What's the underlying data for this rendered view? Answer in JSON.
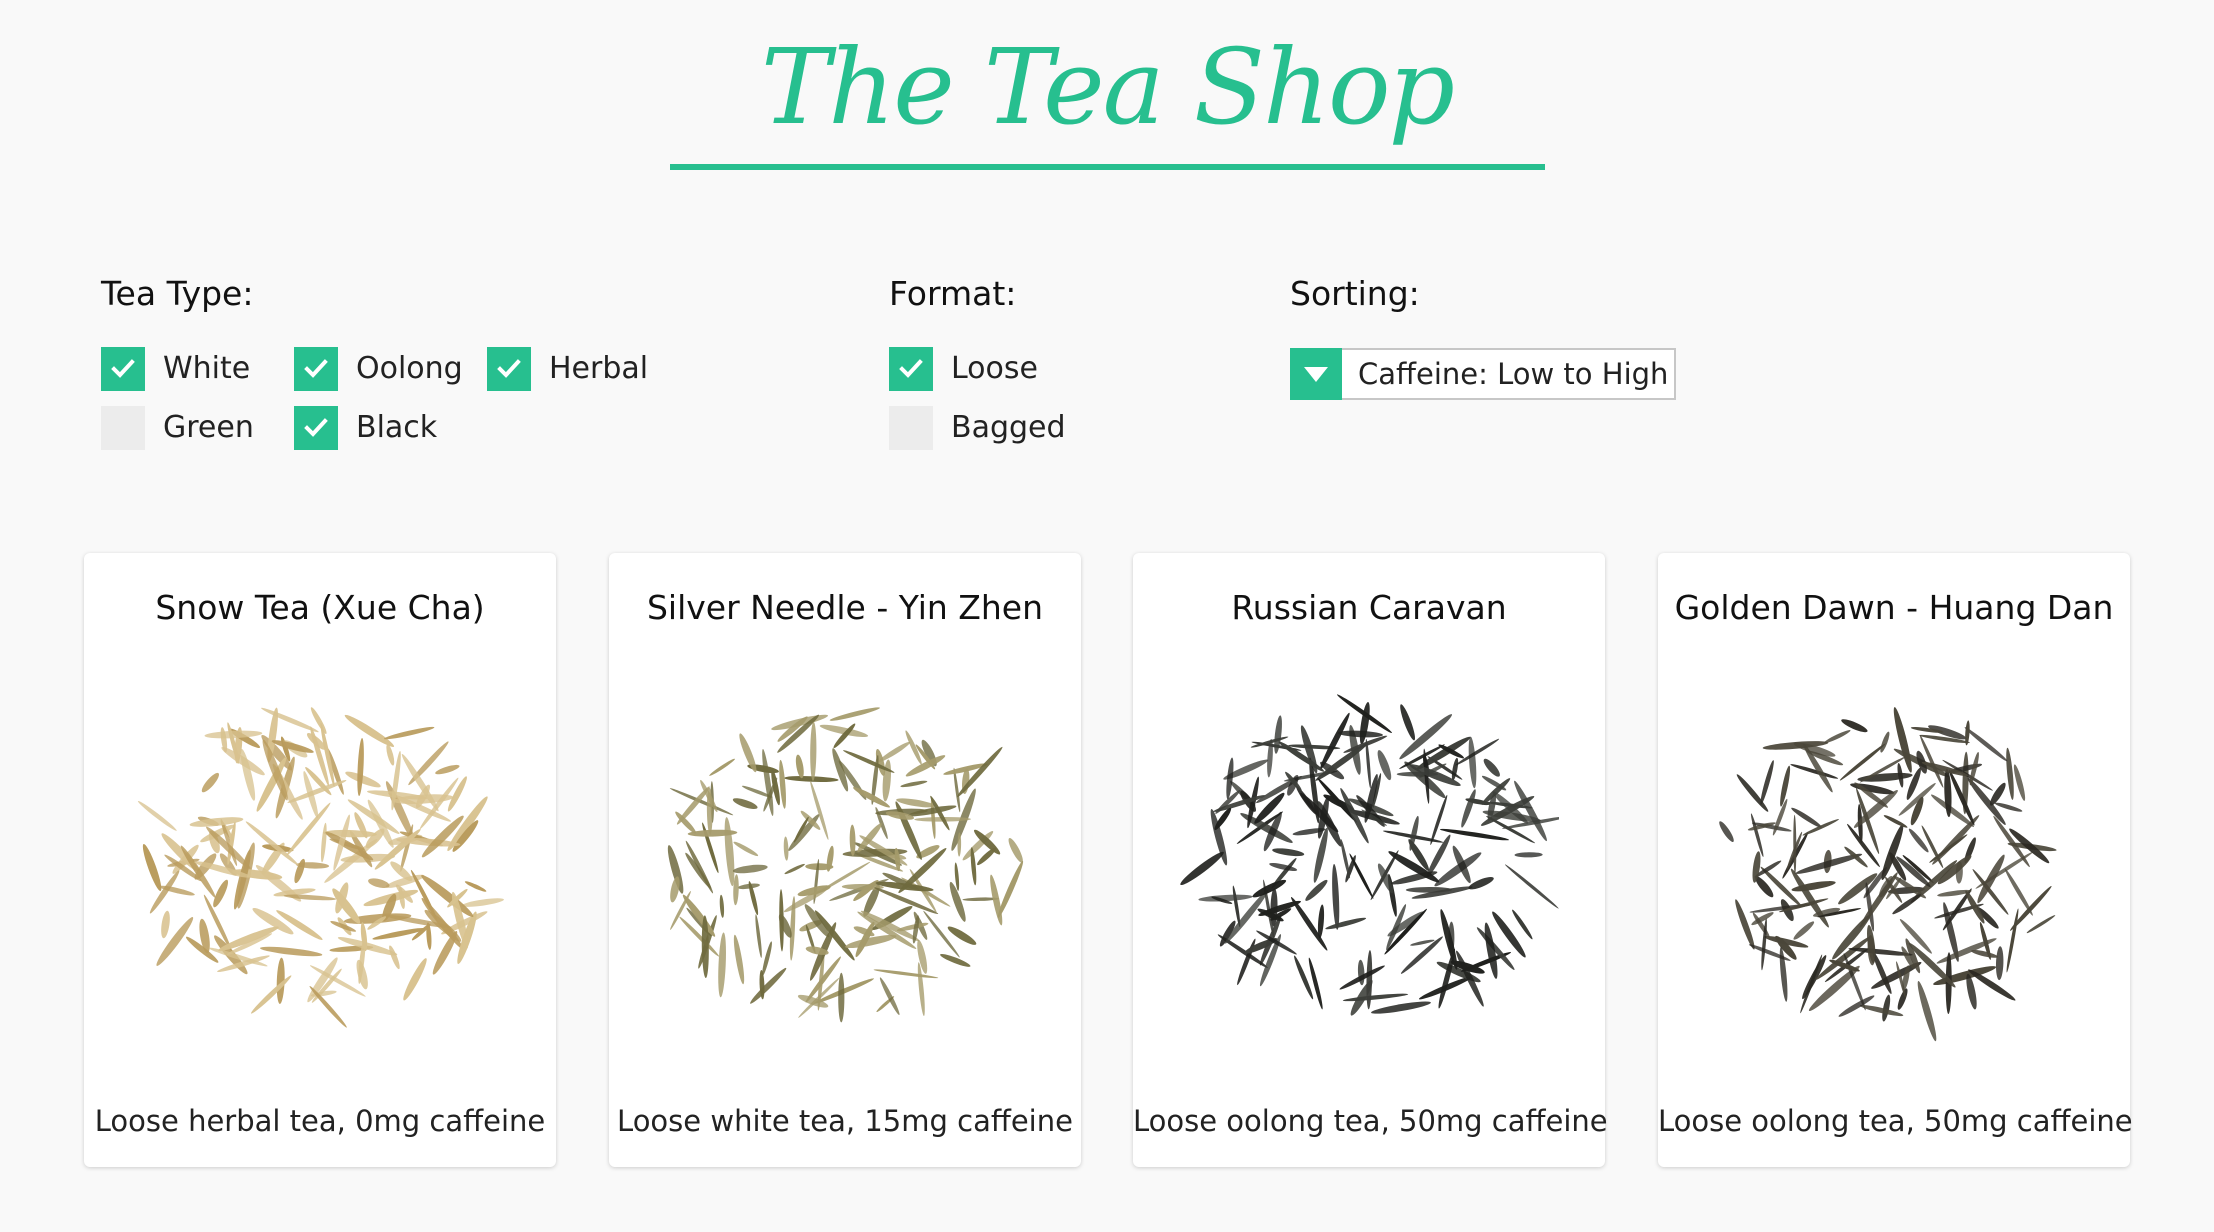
{
  "header": {
    "title": "The Tea Shop"
  },
  "filters": {
    "tea_type": {
      "heading": "Tea Type:",
      "options": [
        {
          "label": "White",
          "checked": true
        },
        {
          "label": "Oolong",
          "checked": true
        },
        {
          "label": "Herbal",
          "checked": true
        },
        {
          "label": "Green",
          "checked": false
        },
        {
          "label": "Black",
          "checked": true
        }
      ]
    },
    "format": {
      "heading": "Format:",
      "options": [
        {
          "label": "Loose",
          "checked": true
        },
        {
          "label": "Bagged",
          "checked": false
        }
      ]
    },
    "sorting": {
      "heading": "Sorting:",
      "selected": "Caffeine: Low to High"
    }
  },
  "colors": {
    "accent": "#27bf8f",
    "page_background": "#f9f9f9",
    "unchecked_box": "#ececec"
  },
  "products": [
    {
      "name": "Snow Tea (Xue Cha)",
      "description": "Loose herbal tea, 0mg caffeine",
      "leaf_color": "#d8c28f",
      "leaf_shade": "#b99b5c"
    },
    {
      "name": "Silver Needle - Yin Zhen",
      "description": "Loose white tea, 15mg caffeine",
      "leaf_color": "#a59b6b",
      "leaf_shade": "#6f6a3e"
    },
    {
      "name": "Russian Caravan",
      "description": "Loose oolong tea, 50mg caffeine",
      "leaf_color": "#3b3d38",
      "leaf_shade": "#1f201d"
    },
    {
      "name": "Golden Dawn - Huang Dan",
      "description": "Loose oolong tea, 50mg caffeine",
      "leaf_color": "#4a4639",
      "leaf_shade": "#2a2822"
    }
  ]
}
